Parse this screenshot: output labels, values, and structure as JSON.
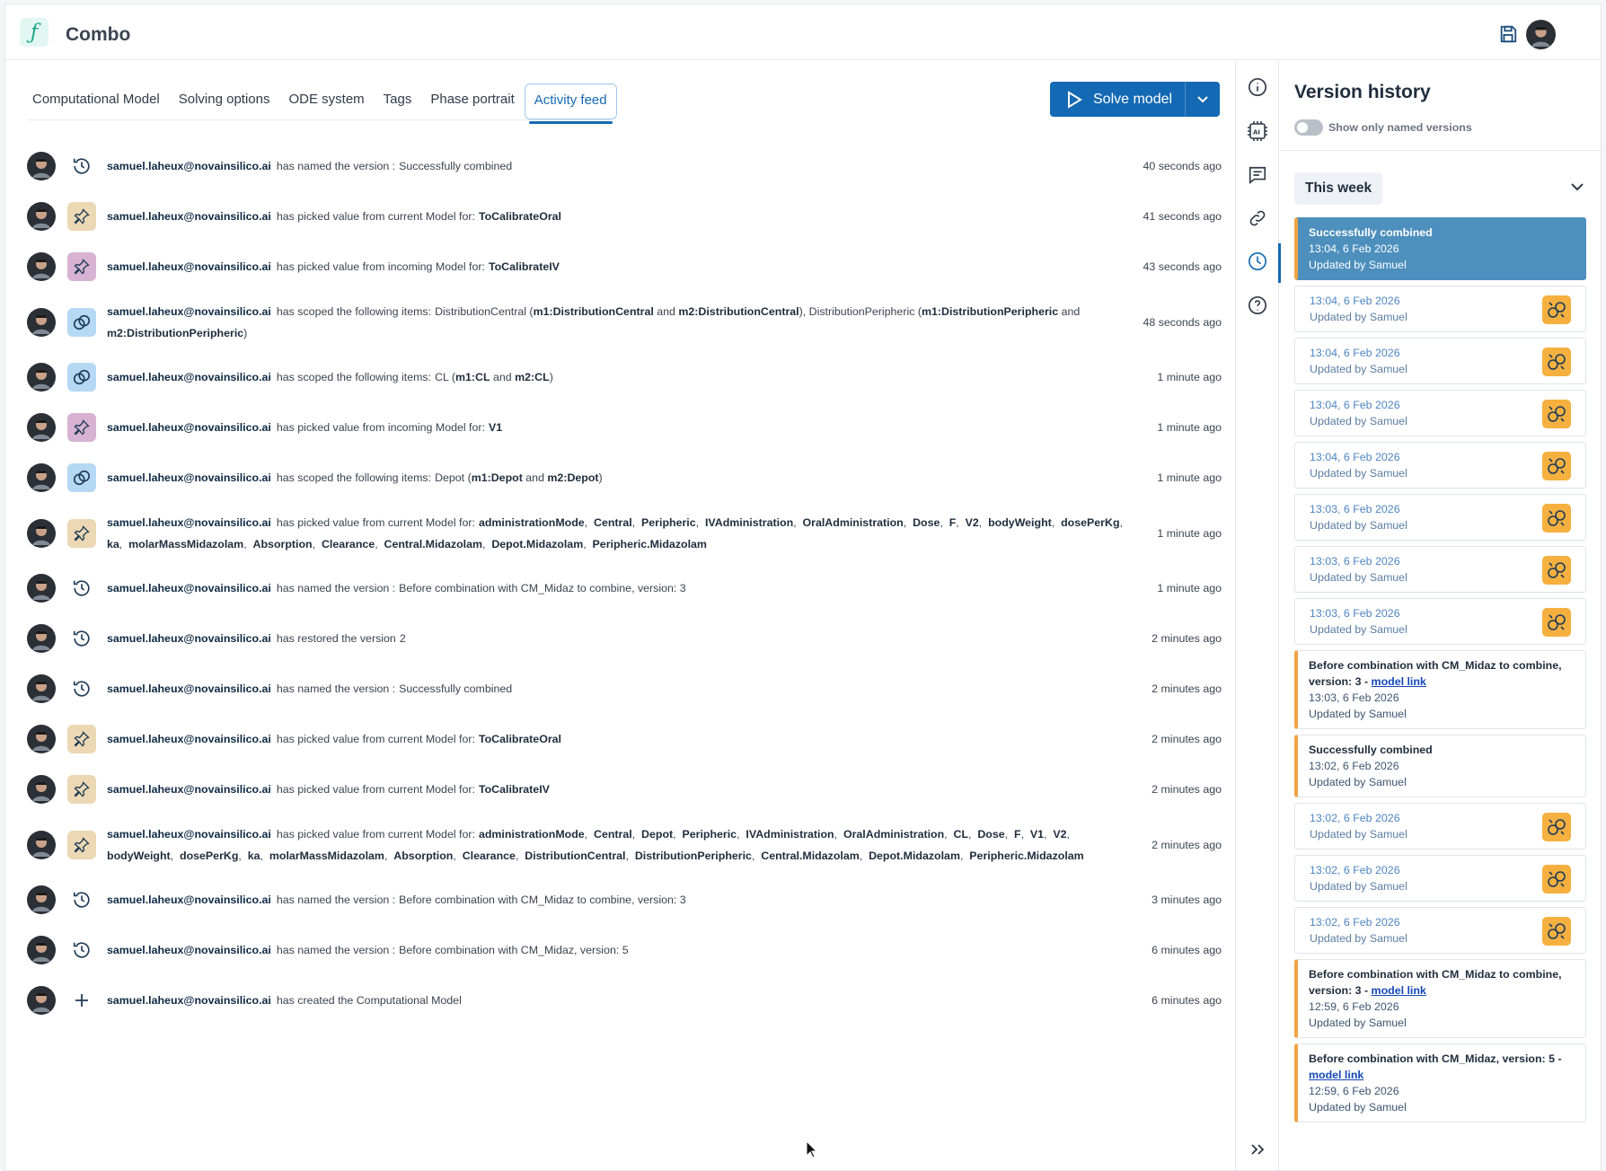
{
  "app": {
    "title": "Combo"
  },
  "tabs": [
    "Computational Model",
    "Solving options",
    "ODE system",
    "Tags",
    "Phase portrait",
    "Activity feed"
  ],
  "active_tab": "Activity feed",
  "solve": {
    "label": "Solve model"
  },
  "colors": {
    "accent": "#1469b4",
    "pin_current": "#ecd8b4",
    "pin_incoming": "#d7b2d3",
    "scope": "#b5d9f3",
    "named_marker": "#f0a443",
    "merge_icon": "#f5b03f"
  },
  "feed": [
    {
      "badge": "clock-icon",
      "user": "samuel.laheux@novainsilico.ai",
      "action": "has named the version :",
      "detail_html": "Successfully combined",
      "time": "40 seconds ago"
    },
    {
      "badge": "pin-current-icon",
      "user": "samuel.laheux@novainsilico.ai",
      "action": "has picked value from current Model for:",
      "detail_html": "<b>ToCalibrateOral</b>",
      "time": "41 seconds ago"
    },
    {
      "badge": "pin-incoming-icon",
      "user": "samuel.laheux@novainsilico.ai",
      "action": "has picked value from incoming Model for:",
      "detail_html": "<b>ToCalibrateIV</b>",
      "time": "43 seconds ago"
    },
    {
      "badge": "scope-icon",
      "user": "samuel.laheux@novainsilico.ai",
      "action": "has scoped the following items:",
      "detail_html": "DistributionCentral (<b>m1:DistributionCentral</b> and <b>m2:DistributionCentral</b>), DistributionPeripheric (<b>m1:DistributionPeripheric</b> and <b>m2:DistributionPeripheric</b>)",
      "time": "48 seconds ago",
      "tall": true
    },
    {
      "badge": "scope-icon",
      "user": "samuel.laheux@novainsilico.ai",
      "action": "has scoped the following items:",
      "detail_html": "CL (<b>m1:CL</b> and <b>m2:CL</b>)",
      "time": "1 minute ago"
    },
    {
      "badge": "pin-incoming-icon",
      "user": "samuel.laheux@novainsilico.ai",
      "action": "has picked value from incoming Model for:",
      "detail_html": "<b>V1</b>",
      "time": "1 minute ago"
    },
    {
      "badge": "scope-icon",
      "user": "samuel.laheux@novainsilico.ai",
      "action": "has scoped the following items:",
      "detail_html": "Depot (<b>m1:Depot</b> and <b>m2:Depot</b>)",
      "time": "1 minute ago"
    },
    {
      "badge": "pin-current-icon",
      "user": "samuel.laheux@novainsilico.ai",
      "action": "has picked value from current Model for:",
      "detail_html": "<b>administrationMode</b>,&nbsp; <b>Central</b>,&nbsp; <b>Peripheric</b>,&nbsp; <b>IVAdministration</b>,&nbsp; <b>OralAdministration</b>,&nbsp; <b>Dose</b>,&nbsp; <b>F</b>,&nbsp; <b>V2</b>,&nbsp; <b>bodyWeight</b>,&nbsp; <b>dosePerKg</b>,&nbsp; <b>ka</b>,&nbsp; <b>molarMassMidazolam</b>,&nbsp; <b>Absorption</b>,&nbsp; <b>Clearance</b>,&nbsp; <b>Central.Midazolam</b>,&nbsp; <b>Depot.Midazolam</b>,&nbsp; <b>Peripheric.Midazolam</b>",
      "time": "1 minute ago",
      "tall": true
    },
    {
      "badge": "clock-icon",
      "user": "samuel.laheux@novainsilico.ai",
      "action": "has named the version :",
      "detail_html": "Before combination with CM_Midaz to combine, version: 3",
      "time": "1 minute ago"
    },
    {
      "badge": "clock-icon",
      "user": "samuel.laheux@novainsilico.ai",
      "action": "has restored the version",
      "detail_html": "2",
      "time": "2 minutes ago"
    },
    {
      "badge": "clock-icon",
      "user": "samuel.laheux@novainsilico.ai",
      "action": "has named the version :",
      "detail_html": "Successfully combined",
      "time": "2 minutes ago"
    },
    {
      "badge": "pin-current-icon",
      "user": "samuel.laheux@novainsilico.ai",
      "action": "has picked value from current Model for:",
      "detail_html": "<b>ToCalibrateOral</b>",
      "time": "2 minutes ago"
    },
    {
      "badge": "pin-current-icon",
      "user": "samuel.laheux@novainsilico.ai",
      "action": "has picked value from current Model for:",
      "detail_html": "<b>ToCalibrateIV</b>",
      "time": "2 minutes ago"
    },
    {
      "badge": "pin-current-icon",
      "user": "samuel.laheux@novainsilico.ai",
      "action": "has picked value from current Model for:",
      "detail_html": "<b>administrationMode</b>,&nbsp; <b>Central</b>,&nbsp; <b>Depot</b>,&nbsp; <b>Peripheric</b>,&nbsp; <b>IVAdministration</b>,&nbsp; <b>OralAdministration</b>,&nbsp; <b>CL</b>,&nbsp; <b>Dose</b>,&nbsp; <b>F</b>,&nbsp; <b>V1</b>,&nbsp; <b>V2</b>,&nbsp; <b>bodyWeight</b>,&nbsp; <b>dosePerKg</b>,&nbsp; <b>ka</b>,&nbsp; <b>molarMassMidazolam</b>,&nbsp; <b>Absorption</b>,&nbsp; <b>Clearance</b>,&nbsp; <b>DistributionCentral</b>,&nbsp; <b>DistributionPeripheric</b>,&nbsp; <b>Central.Midazolam</b>,&nbsp; <b>Depot.Midazolam</b>,&nbsp; <b>Peripheric.Midazolam</b>",
      "time": "2 minutes ago",
      "tall": true
    },
    {
      "badge": "clock-icon",
      "user": "samuel.laheux@novainsilico.ai",
      "action": "has named the version :",
      "detail_html": "Before combination with CM_Midaz to combine, version: 3",
      "time": "3 minutes ago"
    },
    {
      "badge": "clock-icon",
      "user": "samuel.laheux@novainsilico.ai",
      "action": "has named the version :",
      "detail_html": "Before combination with CM_Midaz, version: 5",
      "time": "6 minutes ago"
    },
    {
      "badge": "plus-icon",
      "user": "samuel.laheux@novainsilico.ai",
      "action": "has created the Computational Model",
      "detail_html": "",
      "time": "6 minutes ago"
    }
  ],
  "version_history": {
    "title": "Version history",
    "toggle_label": "Show only named versions",
    "group_label": "This week",
    "items": [
      {
        "name": "Successfully combined",
        "time": "13:04, 6 Feb 2026",
        "by": "Updated by Samuel",
        "named": true,
        "selected": true
      },
      {
        "time": "13:04, 6 Feb 2026",
        "by": "Updated by Samuel",
        "merge": true
      },
      {
        "time": "13:04, 6 Feb 2026",
        "by": "Updated by Samuel",
        "merge": true
      },
      {
        "time": "13:04, 6 Feb 2026",
        "by": "Updated by Samuel",
        "merge": true
      },
      {
        "time": "13:04, 6 Feb 2026",
        "by": "Updated by Samuel",
        "merge": true
      },
      {
        "time": "13:03, 6 Feb 2026",
        "by": "Updated by Samuel",
        "merge": true
      },
      {
        "time": "13:03, 6 Feb 2026",
        "by": "Updated by Samuel",
        "merge": true
      },
      {
        "time": "13:03, 6 Feb 2026",
        "by": "Updated by Samuel",
        "merge": true
      },
      {
        "name": "Before combination with CM_Midaz to combine, version: 3 - ",
        "link": "model link",
        "time": "13:03, 6 Feb 2026",
        "by": "Updated by Samuel",
        "named": true
      },
      {
        "name": "Successfully combined",
        "time": "13:02, 6 Feb 2026",
        "by": "Updated by Samuel",
        "named": true
      },
      {
        "time": "13:02, 6 Feb 2026",
        "by": "Updated by Samuel",
        "merge": true
      },
      {
        "time": "13:02, 6 Feb 2026",
        "by": "Updated by Samuel",
        "merge": true
      },
      {
        "time": "13:02, 6 Feb 2026",
        "by": "Updated by Samuel",
        "merge": true
      },
      {
        "name": "Before combination with CM_Midaz to combine, version: 3 - ",
        "link": "model link",
        "time": "12:59, 6 Feb 2026",
        "by": "Updated by Samuel",
        "named": true
      },
      {
        "name": "Before combination with CM_Midaz, version: 5 - ",
        "link": "model link",
        "time": "12:59, 6 Feb 2026",
        "by": "Updated by Samuel",
        "named": true
      }
    ]
  }
}
